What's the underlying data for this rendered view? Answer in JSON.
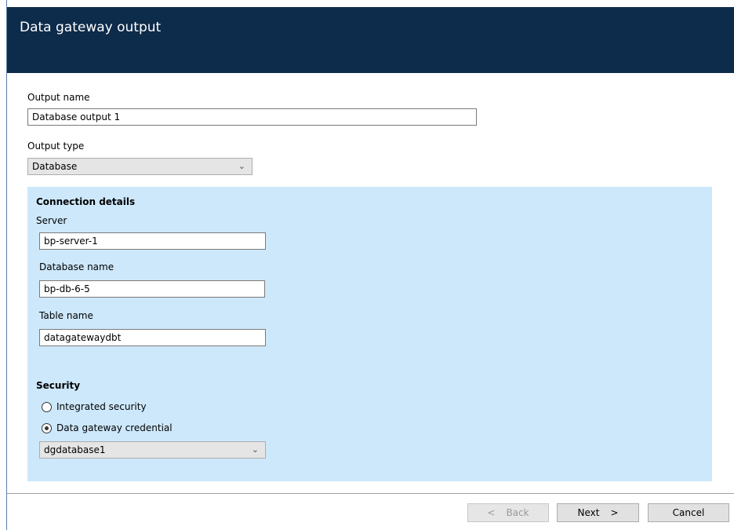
{
  "window": {
    "title": "Data gateway output"
  },
  "form": {
    "output_name_label": "Output name",
    "output_name_value": "Database output 1",
    "output_type_label": "Output type",
    "output_type_value": "Database"
  },
  "connection": {
    "heading": "Connection details",
    "server_label": "Server",
    "server_value": "bp-server-1",
    "database_label": "Database name",
    "database_value": "bp-db-6-5",
    "table_label": "Table name",
    "table_value": "datagatewaydbt"
  },
  "security": {
    "heading": "Security",
    "option_integrated": "Integrated security",
    "option_credential": "Data gateway credential",
    "selected": "credential",
    "credential_value": "dgdatabase1"
  },
  "buttons": {
    "back": "Back",
    "next": "Next",
    "cancel": "Cancel"
  },
  "colors": {
    "header_bg": "#0d2b4a",
    "panel_bg": "#cde8fb"
  }
}
